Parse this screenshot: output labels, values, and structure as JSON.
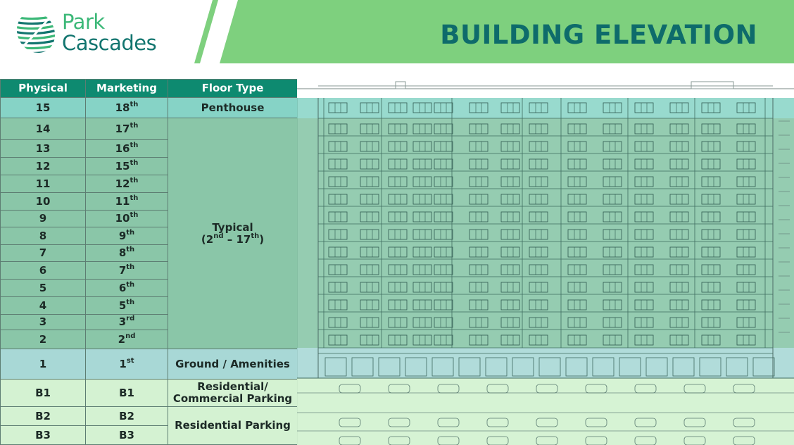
{
  "brand": {
    "line1": "Park",
    "line2": "Cascades"
  },
  "title": "BUILDING ELEVATION",
  "table": {
    "headers": [
      "Physical",
      "Marketing",
      "Floor Type"
    ],
    "typical_label": "Typical",
    "typical_range": {
      "from": "2",
      "from_sup": "nd",
      "sep": " – ",
      "to": "17",
      "to_sup": "th"
    },
    "rows": [
      {
        "physical": "15",
        "m": "18",
        "sup": "th",
        "type": "Penthouse"
      },
      {
        "physical": "14",
        "m": "17",
        "sup": "th"
      },
      {
        "physical": "13",
        "m": "16",
        "sup": "th"
      },
      {
        "physical": "12",
        "m": "15",
        "sup": "th"
      },
      {
        "physical": "11",
        "m": "12",
        "sup": "th"
      },
      {
        "physical": "10",
        "m": "11",
        "sup": "th"
      },
      {
        "physical": "9",
        "m": "10",
        "sup": "th"
      },
      {
        "physical": "8",
        "m": "9",
        "sup": "th"
      },
      {
        "physical": "7",
        "m": "8",
        "sup": "th"
      },
      {
        "physical": "6",
        "m": "7",
        "sup": "th"
      },
      {
        "physical": "5",
        "m": "6",
        "sup": "th"
      },
      {
        "physical": "4",
        "m": "5",
        "sup": "th"
      },
      {
        "physical": "3",
        "m": "3",
        "sup": "rd"
      },
      {
        "physical": "2",
        "m": "2",
        "sup": "nd"
      },
      {
        "physical": "1",
        "m": "1",
        "sup": "st",
        "type": "Ground / Amenities"
      },
      {
        "physical": "B1",
        "m": "B1",
        "sup": "",
        "type_l1": "Residential/",
        "type_l2": "Commercial Parking"
      },
      {
        "physical": "B2",
        "m": "B2",
        "sup": "",
        "type": "Residential Parking"
      },
      {
        "physical": "B3",
        "m": "B3",
        "sup": ""
      }
    ]
  },
  "colors": {
    "penthouse": "#86d3c6",
    "typical": "#8ac6a8",
    "ground": "#a8d8d6",
    "parking": "#d4f2d2",
    "header": "#0e8a70",
    "band": "#7ed07e",
    "title": "#0e6b6b"
  },
  "icons": {
    "logo": "leaf-logo-icon"
  }
}
